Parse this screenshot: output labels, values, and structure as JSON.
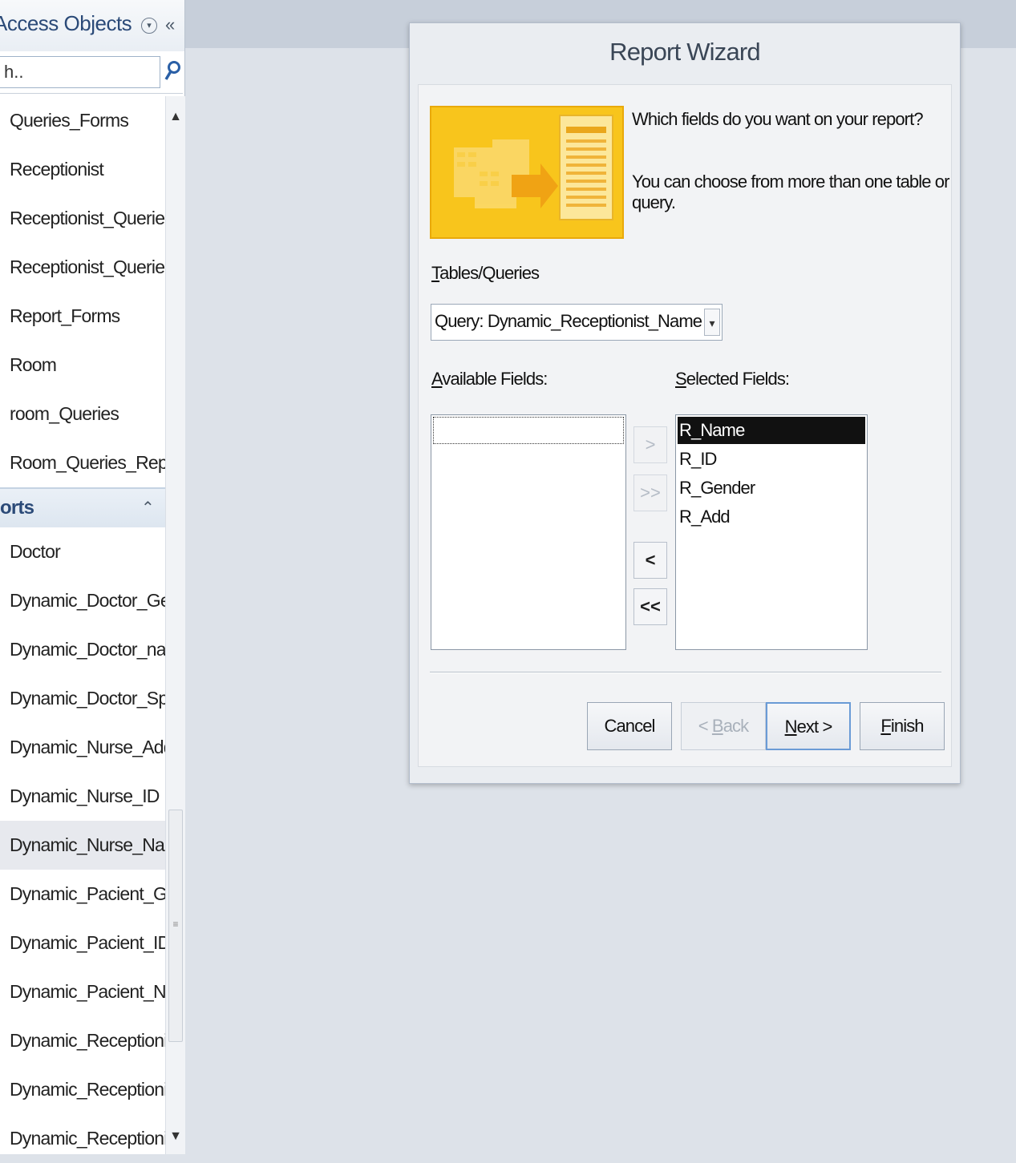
{
  "nav": {
    "title": "Access Objects",
    "search_value": "h..",
    "items_top": [
      "Queries_Forms",
      "Receptionist",
      "Receptionist_Queries",
      "Receptionist_Queries_R...",
      "Report_Forms",
      "Room",
      "room_Queries",
      "Room_Queries_Reports_..."
    ],
    "group_label": "orts",
    "items_reports": [
      "Doctor",
      "Dynamic_Doctor_Gender",
      "Dynamic_Doctor_name",
      "Dynamic_Doctor_Special...",
      "Dynamic_Nurse_Address",
      "Dynamic_Nurse_ID",
      "Dynamic_Nurse_Name",
      "Dynamic_Pacient_Gender",
      "Dynamic_Pacient_ID",
      "Dynamic_Pacient_Name",
      "Dynamic_Receptionist_...",
      "Dynamic_Receptionist_ID",
      "Dynamic_Receptionist_..."
    ],
    "selected_report": "Dynamic_Nurse_Name"
  },
  "dialog": {
    "title": "Report Wizard",
    "prompt_line1": "Which fields do you want on your report?",
    "prompt_line2": "You can choose from more than one table or query.",
    "tables_label_key": "T",
    "tables_label_rest": "ables/Queries",
    "tables_value": "Query: Dynamic_Receptionist_Name",
    "available_label_key": "A",
    "available_label_rest": "vailable Fields:",
    "selected_label_key": "S",
    "selected_label_rest": "elected Fields:",
    "selected_fields": [
      "R_Name",
      "R_ID",
      "R_Gender",
      "R_Add"
    ],
    "move_buttons": {
      "add_one": ">",
      "add_all": ">>",
      "remove_one": "<",
      "remove_all": "<<"
    },
    "buttons": {
      "cancel": "Cancel",
      "back_pre": "< ",
      "back_key": "B",
      "back_rest": "ack",
      "next_key": "N",
      "next_rest": "ext >",
      "finish_key": "F",
      "finish_rest": "inish"
    }
  },
  "colors": {
    "accent": "#2b4a78",
    "graphic": "#f7c11a",
    "selection": "#111111"
  }
}
